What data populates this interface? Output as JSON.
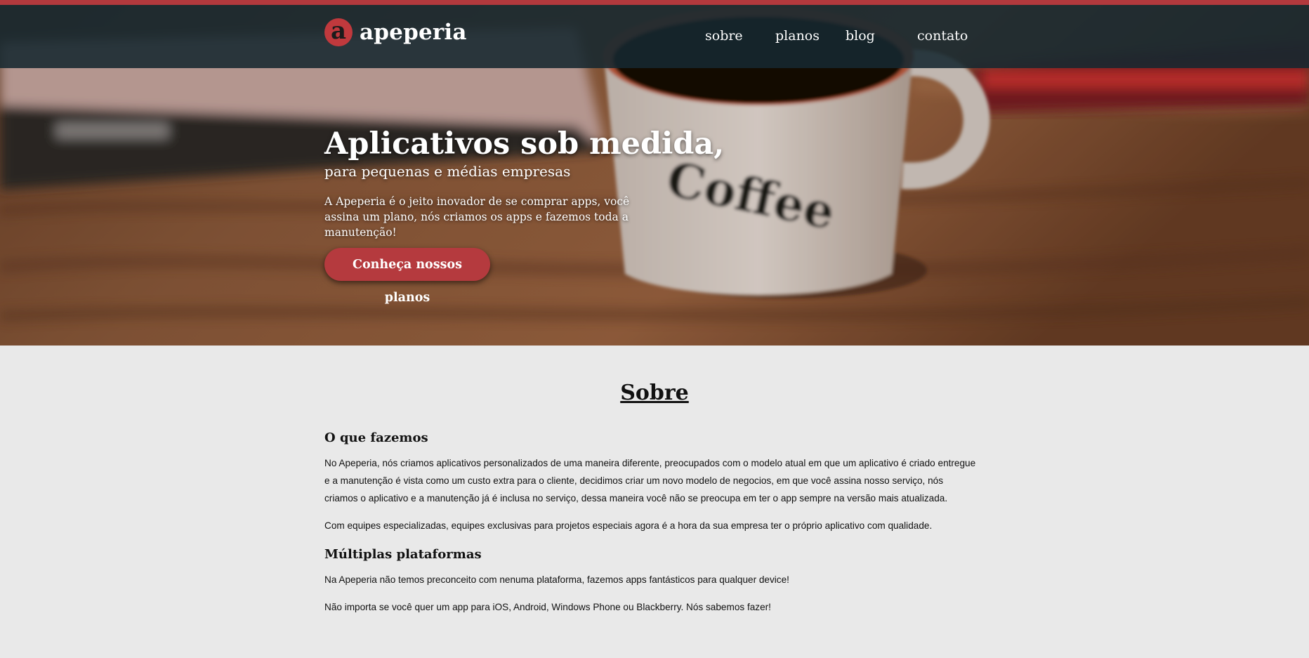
{
  "brand": {
    "logo_letter": "a",
    "name": "apeperia",
    "accent": "#b53a3e",
    "header_bg": "#162830"
  },
  "nav": {
    "items": [
      "sobre",
      "planos",
      "blog",
      "contato"
    ]
  },
  "hero": {
    "title": "Aplicativos sob medida,",
    "subtitle": "para pequenas e médias empresas",
    "description": "A Apeperia é o jeito inovador de se comprar apps, você assina um plano, nós criamos os apps e fazemos toda a manutenção!",
    "cta_label": "Conheça nossos planos",
    "background_image_text": "Coffee"
  },
  "sobre": {
    "heading": "Sobre",
    "sections": [
      {
        "title": "O que fazemos",
        "paragraphs": [
          "No Apeperia, nós criamos aplicativos personalizados de uma maneira diferente, preocupados com o modelo atual em que um aplicativo é criado entregue e a manutenção é vista como um custo extra para o cliente, decidimos criar um novo modelo de negocios, em que você assina nosso serviço, nós criamos o aplicativo e a manutenção já é inclusa no serviço, dessa maneira você não se preocupa em ter o app sempre na versão mais atualizada.",
          "Com equipes especializadas, equipes exclusivas para projetos especiais agora é a hora da sua empresa ter o próprio aplicativo com qualidade."
        ]
      },
      {
        "title": "Múltiplas plataformas",
        "paragraphs": [
          "Na Apeperia não temos preconceito com nenuma plataforma, fazemos apps fantásticos para qualquer device!",
          "Não importa se você quer um app para iOS, Android, Windows Phone ou Blackberry. Nós sabemos fazer!"
        ]
      }
    ]
  }
}
